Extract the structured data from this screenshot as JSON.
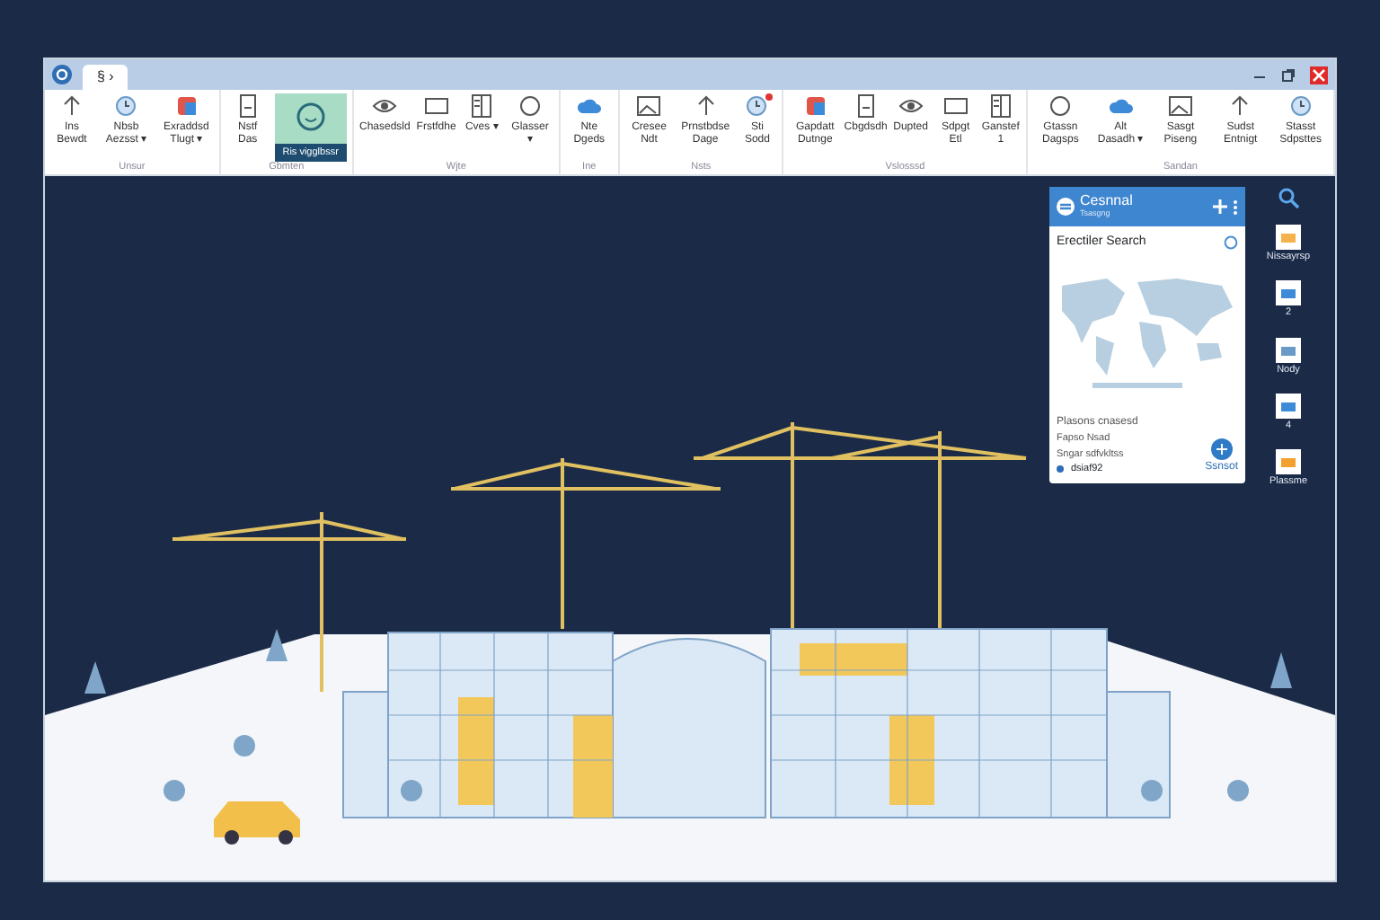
{
  "window": {
    "tab": "§ ›"
  },
  "ribbon": {
    "groups": [
      {
        "label": "Unsur",
        "items": [
          {
            "label": "Ins Bewdt",
            "kind": "small",
            "notified": false
          },
          {
            "label": "Nbsb Aezsst ▾",
            "kind": "small",
            "notified": false
          },
          {
            "label": "Exraddsd Tlugt ▾",
            "kind": "small",
            "notified": false
          }
        ]
      },
      {
        "label": "Gbmten",
        "items": [
          {
            "label": "Nstf Das",
            "kind": "small",
            "notified": false
          },
          {
            "label": "Ris vigglbssr",
            "kind": "large",
            "notified": false
          }
        ]
      },
      {
        "label": "Wjte",
        "items": [
          {
            "label": "Chasedsld",
            "kind": "small",
            "notified": false
          },
          {
            "label": "Frstfdhe",
            "kind": "small",
            "notified": false
          },
          {
            "label": "Cves ▾",
            "kind": "small",
            "notified": false
          },
          {
            "label": "Glasser ▾",
            "kind": "small",
            "notified": false
          }
        ]
      },
      {
        "label": "Ine",
        "items": [
          {
            "label": "Nte Dgeds",
            "kind": "small",
            "notified": false
          }
        ]
      },
      {
        "label": "Nsts",
        "items": [
          {
            "label": "Cresee Ndt",
            "kind": "small",
            "notified": false
          },
          {
            "label": "Prnstbdse Dage",
            "kind": "small",
            "notified": false
          },
          {
            "label": "Sti Sodd",
            "kind": "small",
            "notified": true
          }
        ]
      },
      {
        "label": "Vslosssd",
        "items": [
          {
            "label": "Gapdatt Dutnge",
            "kind": "small",
            "notified": false
          },
          {
            "label": "Cbgdsdh",
            "kind": "small",
            "notified": false
          },
          {
            "label": "Dupted",
            "kind": "small",
            "notified": false
          },
          {
            "label": "Sdpgt Etl",
            "kind": "small",
            "notified": false
          },
          {
            "label": "Ganstef 1",
            "kind": "small",
            "notified": false
          }
        ]
      },
      {
        "label": "Sandan",
        "items": [
          {
            "label": "Gtassn Dagsps",
            "kind": "small",
            "notified": false
          },
          {
            "label": "Alt Dasadh ▾",
            "kind": "small",
            "notified": false
          },
          {
            "label": "Sasgt Piseng",
            "kind": "small",
            "notified": false
          },
          {
            "label": "Sudst Entnigt",
            "kind": "small",
            "notified": false
          },
          {
            "label": "Stasst Sdpsttes",
            "kind": "small",
            "notified": false
          }
        ]
      }
    ]
  },
  "panel": {
    "title": "Cesnnal",
    "subtitle": "Tsasgng",
    "heading": "Erectiler Search",
    "lines": [
      "Plasons cnasesd",
      "Fapso Nsad",
      "Sngar sdfvkltss"
    ],
    "status": "dsiaf92",
    "action": "Ssnsot"
  },
  "side_tools": [
    {
      "label": "Nissayrsp"
    },
    {
      "label": "2"
    },
    {
      "label": "Nody"
    },
    {
      "label": "4"
    },
    {
      "label": "Plassme"
    }
  ]
}
